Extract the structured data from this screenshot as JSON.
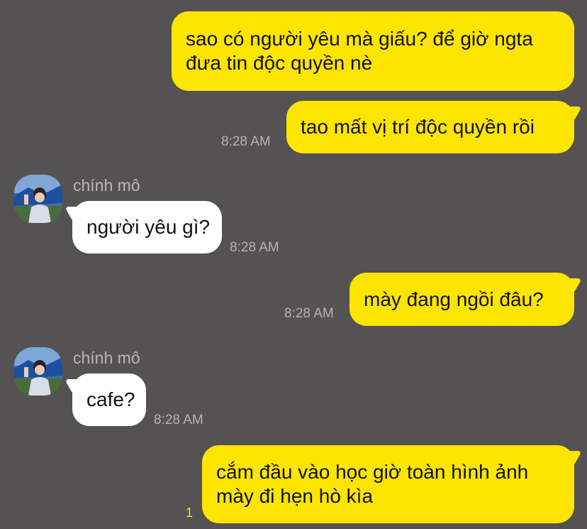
{
  "messages": [
    {
      "from": "me",
      "lines": [
        "sao có người yêu mà giấu? để giờ ngta",
        "đưa tin độc quyền nè"
      ]
    },
    {
      "from": "me",
      "lines": [
        "tao mất vị trí độc quyền rồi"
      ],
      "time": "8:28 AM"
    },
    {
      "from": "other",
      "sender": "chính mô",
      "lines": [
        "người yêu gì?"
      ],
      "time": "8:28 AM"
    },
    {
      "from": "me",
      "lines": [
        "mày đang ngồi đâu?"
      ],
      "time": "8:28 AM"
    },
    {
      "from": "other",
      "sender": "chính mô",
      "lines": [
        "cafe?"
      ],
      "time": "8:28 AM"
    },
    {
      "from": "me",
      "lines": [
        "cắm đầu vào học giờ toàn hình ảnh",
        "mày đi hẹn hò kìa"
      ],
      "unread": "1"
    }
  ],
  "colors": {
    "background": "#545253",
    "outgoing_bubble": "#FEE500",
    "incoming_bubble": "#FFFFFF",
    "timestamp": "#B4B2B3"
  },
  "icons": {
    "avatar": "profile-photo"
  }
}
